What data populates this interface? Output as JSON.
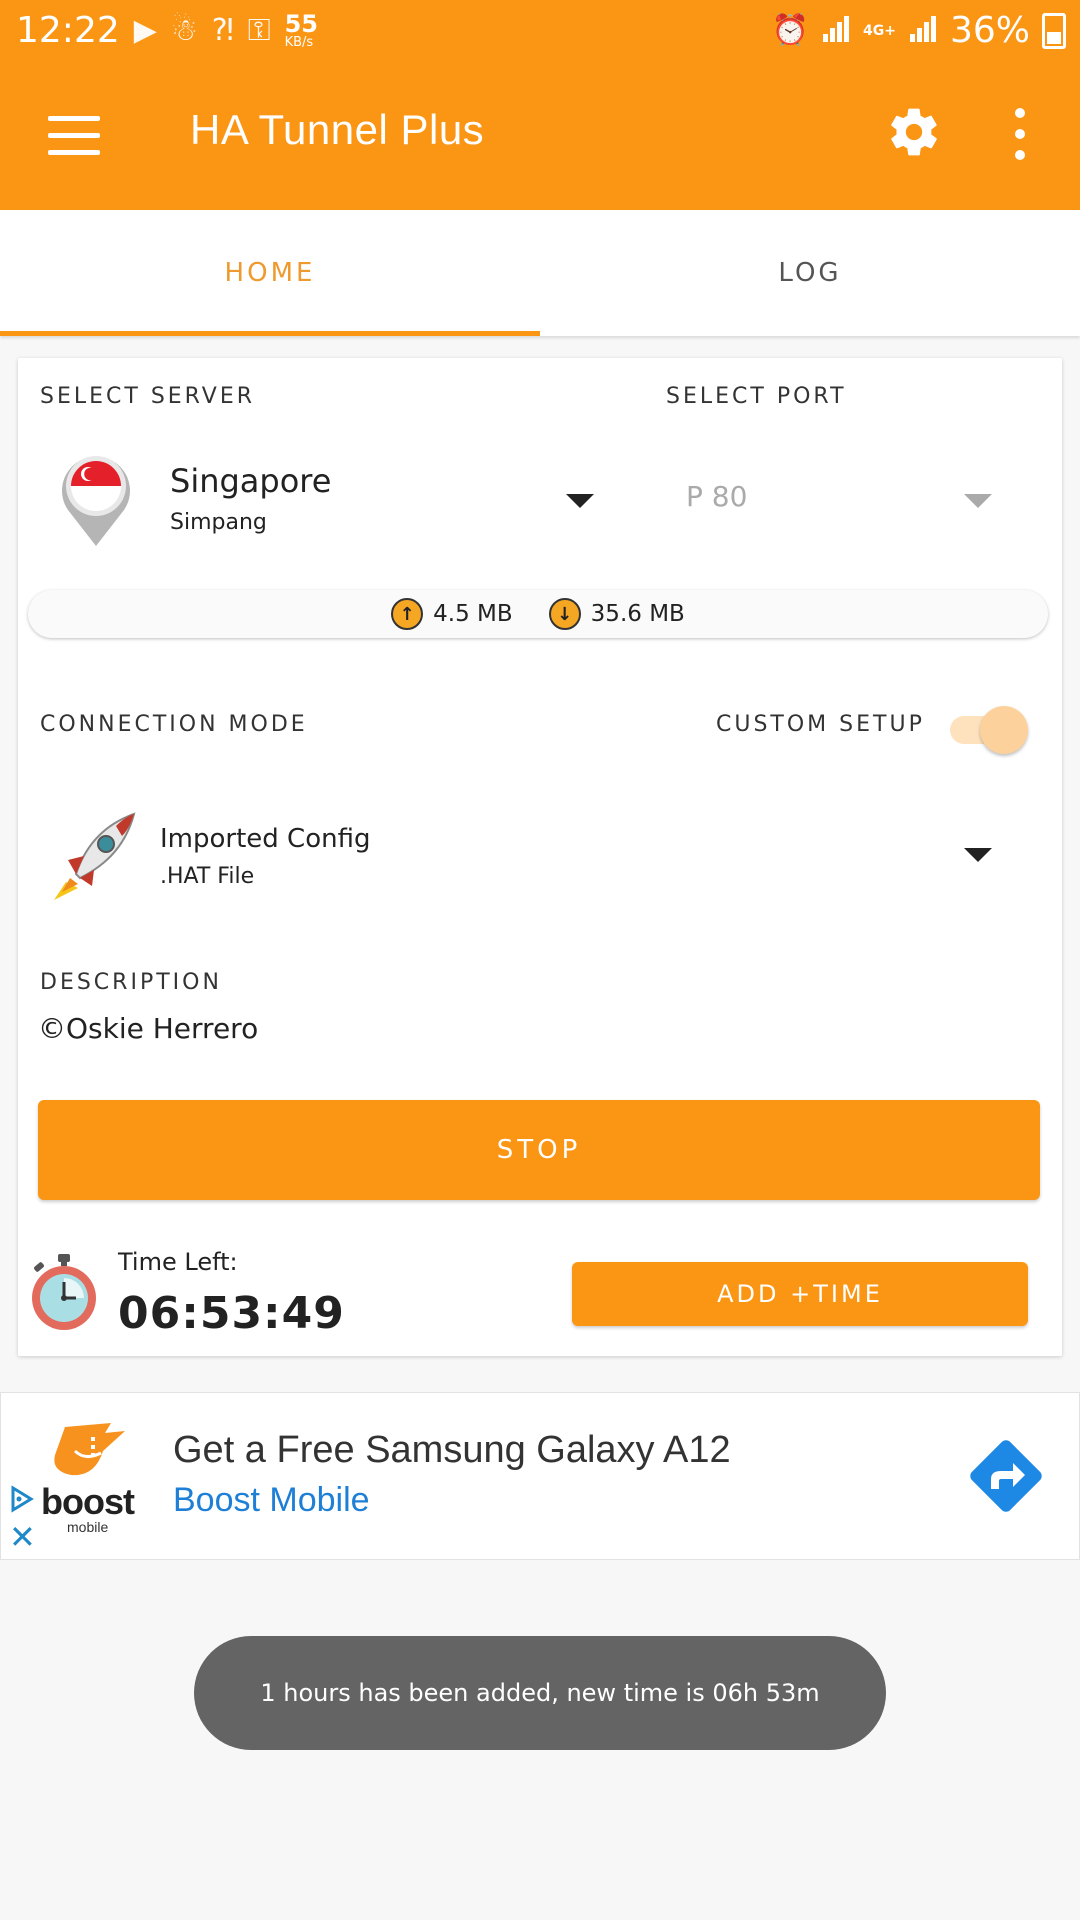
{
  "status_bar": {
    "time": "12:22",
    "speed_value": "55",
    "speed_unit": "KB/s",
    "network": "4G+",
    "battery": "36%"
  },
  "appbar": {
    "title": "HA Tunnel Plus"
  },
  "tabs": [
    {
      "label": "HOME",
      "active": true
    },
    {
      "label": "LOG",
      "active": false
    }
  ],
  "server": {
    "section_label": "SELECT SERVER",
    "name": "Singapore",
    "sub": "Simpang"
  },
  "port": {
    "section_label": "SELECT PORT",
    "value": "P 80"
  },
  "traffic": {
    "upload": "4.5 MB",
    "download": "35.6 MB"
  },
  "connection": {
    "section_label": "CONNECTION MODE",
    "custom_setup_label": "CUSTOM SETUP",
    "custom_setup_on": true,
    "mode_name": "Imported Config",
    "mode_sub": ".HAT File"
  },
  "description": {
    "label": "DESCRIPTION",
    "value": "©Oskie Herrero"
  },
  "actions": {
    "stop_label": "STOP",
    "add_time_label": "ADD +TIME"
  },
  "timer": {
    "label": "Time Left:",
    "value": "06:53:49"
  },
  "ad": {
    "brand": "boost",
    "brand_sub": "mobile",
    "title": "Get a Free Samsung Galaxy A12",
    "subtitle": "Boost Mobile"
  },
  "toast": {
    "message": "1 hours has been added, new time is 06h 53m"
  },
  "colors": {
    "accent": "#fb9514",
    "ad_link": "#1e7fd6"
  }
}
